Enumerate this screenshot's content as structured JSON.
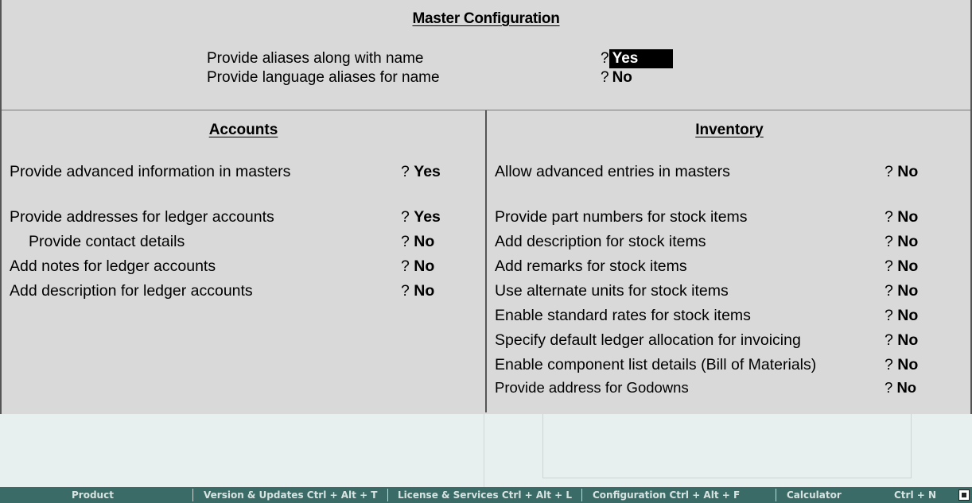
{
  "title": "Master Configuration",
  "question_mark": "?",
  "top_options": [
    {
      "label": "Provide aliases along with name",
      "value": "Yes"
    },
    {
      "label": "Provide language aliases for name",
      "value": "No"
    }
  ],
  "accounts": {
    "heading": "Accounts",
    "options": [
      {
        "label": "Provide advanced information in masters",
        "value": "Yes"
      },
      {
        "label": "Provide addresses for ledger accounts",
        "value": "Yes"
      },
      {
        "label": "Provide contact details",
        "value": "No"
      },
      {
        "label": "Add notes for ledger accounts",
        "value": "No"
      },
      {
        "label": "Add description for ledger accounts",
        "value": "No"
      }
    ]
  },
  "inventory": {
    "heading": "Inventory",
    "options": [
      {
        "label": "Allow advanced entries in masters",
        "value": "No"
      },
      {
        "label": "Provide part numbers for stock items",
        "value": "No"
      },
      {
        "label": "Add description for stock items",
        "value": "No"
      },
      {
        "label": "Add remarks for stock items",
        "value": "No"
      },
      {
        "label": "Use alternate units for stock items",
        "value": "No"
      },
      {
        "label": "Enable standard rates for stock items",
        "value": "No"
      },
      {
        "label": "Specify default ledger allocation for invoicing",
        "value": "No"
      },
      {
        "label": "Enable component list details (Bill of Materials)",
        "value": "No"
      },
      {
        "label": "Provide address for Godowns",
        "value": "No"
      }
    ]
  },
  "status_bar": {
    "items": [
      "Product",
      "Version & Updates Ctrl + Alt + T",
      "License & Services Ctrl + Alt + L",
      "Configuration   Ctrl + Alt + F",
      "Calculator",
      "Ctrl + N"
    ],
    "colors": {
      "background": "#3b6b67",
      "text": "#d8e4e2"
    }
  }
}
